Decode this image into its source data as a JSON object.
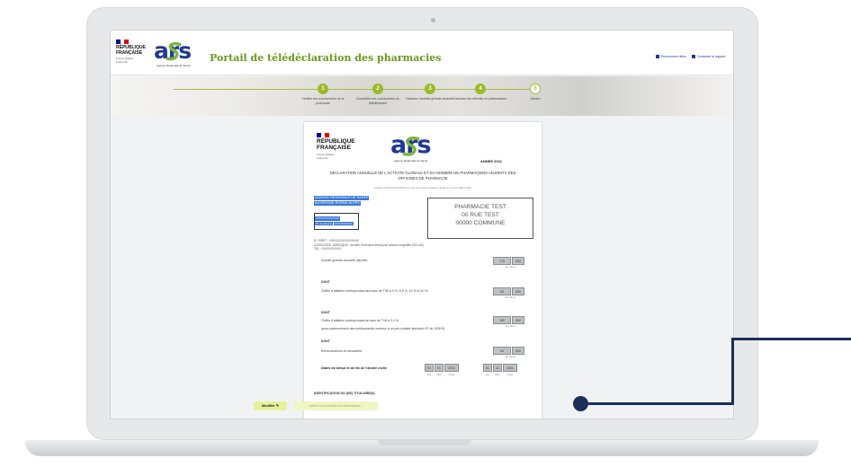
{
  "header": {
    "republique": "RÉPUBLIQUE FRANÇAISE",
    "motto": "Liberté Égalité Fraternité",
    "ars_logo": "ars",
    "ars_subtitle": "Agence Régionale de Santé",
    "portal_title": "Portail de télédéclaration des pharmacies",
    "links": [
      "Ressources utiles",
      "Contacter le support"
    ]
  },
  "steps": [
    {
      "number": "1",
      "label": "Vérifiez les coordonnées de la pharmacie"
    },
    {
      "number": "2",
      "label": "Complétez les coordonnées du télédéclarant"
    },
    {
      "number": "3",
      "label": "Déclarez l'activité globale annuelle"
    },
    {
      "number": "4",
      "label": "Déclarez les effectifs en pharmaciens"
    },
    {
      "number": "5",
      "label": "Validez"
    }
  ],
  "document": {
    "republique": "RÉPUBLIQUE FRANÇAISE",
    "motto": "Liberté Égalité Fraternité",
    "ars_logo": "ars",
    "ars_subtitle": "Agence Régionale de Santé",
    "year": "ANNEE 2021",
    "heading": "DECLARATION ANNUELLE DE L'ACTIVITE GLOBALE ET DU NOMBRE DE PHARMACIENS ADJOINTS DES OFFICINES DE PHARMACIE",
    "reference": "Articles L.5125-10 et D.5125-4 du code de la santé publique et arrêté du 14 avril 1998 modifié",
    "agency": [
      "AGENCE REGIONALE DE SANTE",
      "AUVERGNE-RHÔNE-ALPES"
    ],
    "service_lines": [
      "XXXXXXXXXXXXX",
      "N° de licence"
    ],
    "service_value": "XXXXXXXXXX",
    "address": [
      "PHARMACIE TEST",
      "00 RUE TEST",
      "00000 COMMUNE"
    ],
    "siret": "N° SIRET : XXXXXXXXXXXXXXX",
    "category": "CATEGORIE JURIDIQUE : société d'exercice libéral par actions simplifiée (SELAS)",
    "tel": "TEL : XXXXXXXXXX",
    "rows": [
      {
        "kind": "row",
        "label": "Activité globale annuelle calculée",
        "values": [
          "170",
          "000"
        ],
        "unit": "En milliers"
      },
      {
        "kind": "dont",
        "label": "DONT"
      },
      {
        "kind": "row",
        "label": "Chiffre d'affaires correspondant aux taux de TVA à 0 %, 5,5 %, 10 % et 20 %",
        "values": [
          "30",
          "000"
        ],
        "unit": "En milliers"
      },
      {
        "kind": "dont",
        "label": "DONT"
      },
      {
        "kind": "row",
        "label": "Chiffre d'affaires correspondant au taux de TVA à 2,1 %",
        "values": [
          "100",
          "000"
        ],
        "unit": "En milliers"
      },
      {
        "kind": "note",
        "label": "(avec plafonnement des médicaments onéreux à un prix unitaire fabricant HT de 1930 €)"
      },
      {
        "kind": "dont",
        "label": "DONT"
      },
      {
        "kind": "row",
        "label": "Rémunérations et honoraires",
        "values": [
          "20",
          "000"
        ],
        "unit": "En milliers"
      }
    ],
    "dates_label": "Dates de début et de fin de l'année civile",
    "date_start": [
      "01",
      "01",
      "2021"
    ],
    "date_end": [
      "31",
      "12",
      "2021"
    ],
    "date_captions": [
      "Jour",
      "Mois",
      "Année"
    ],
    "ident_label": "IDENTIFICATION DU (DE) TITULAIRE(S)"
  },
  "actions": {
    "modifier": "Modifier",
    "valider": "Valider et transmettre les déclarations"
  },
  "colors": {
    "ars_blue": "#1f3a93",
    "accent_green": "#9cbb29",
    "callout": "#1c2d57",
    "selection": "#3a78d8"
  }
}
